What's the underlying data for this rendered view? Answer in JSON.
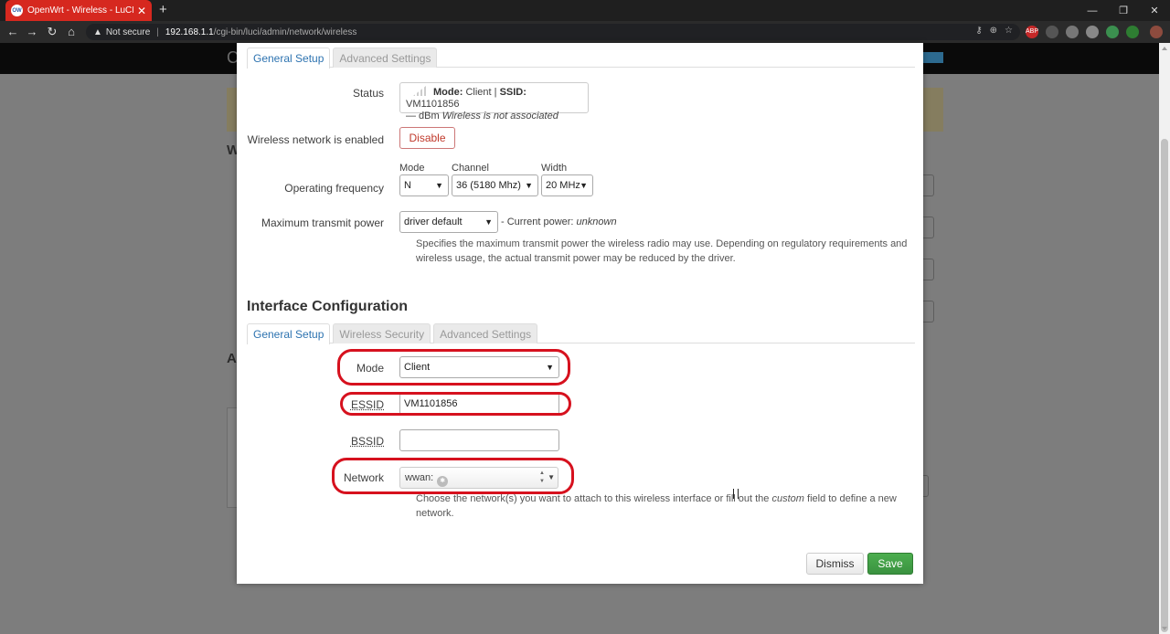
{
  "browser": {
    "tab_title": "OpenWrt - Wireless - LuCI",
    "tab_close": "✕",
    "new_tab": "+",
    "security": "Not secure",
    "url_host": "192.168.1.1",
    "url_path": "/cgi-bin/luci/admin/network/wireless",
    "window_minimize": "—",
    "window_restore": "❐",
    "window_close": "✕"
  },
  "modal": {
    "device_tabs": [
      "General Setup",
      "Advanced Settings"
    ],
    "status": {
      "label": "Status",
      "mode_key": "Mode:",
      "mode_value": "Client",
      "ssid_key": "SSID:",
      "ssid_value": "VM1101856",
      "signal": "— dBm",
      "assoc": "Wireless is not associated"
    },
    "enabled": {
      "label": "Wireless network is enabled",
      "button": "Disable"
    },
    "frequency": {
      "label": "Operating frequency",
      "mode_label": "Mode",
      "mode_value": "N",
      "channel_label": "Channel",
      "channel_value": "36 (5180 Mhz)",
      "width_label": "Width",
      "width_value": "20 MHz"
    },
    "txpower": {
      "label": "Maximum transmit power",
      "value": "driver default",
      "current_prefix": "- Current power:",
      "current_value": "unknown",
      "help_line1": "Specifies the maximum transmit power the wireless radio may use. Depending on regulatory requirements and",
      "help_line2": "wireless usage, the actual transmit power may be reduced by the driver."
    },
    "iface_title": "Interface Configuration",
    "iface_tabs": [
      "General Setup",
      "Wireless Security",
      "Advanced Settings"
    ],
    "mode": {
      "label": "Mode",
      "value": "Client"
    },
    "essid": {
      "label": "ESSID",
      "value": "VM1101856"
    },
    "bssid": {
      "label": "BSSID",
      "value": ""
    },
    "network": {
      "label": "Network",
      "value": "wwan:",
      "help_pre": "Choose the network(s) you want to attach to this wireless interface or fill out the",
      "help_em": "custom",
      "help_post": "field to define a new",
      "help_line2": "network."
    },
    "buttons": {
      "dismiss": "Dismiss",
      "save": "Save"
    }
  },
  "colors": {
    "highlight": "#d6111e",
    "save_green": "#43a047",
    "tab_active": "#2d73b0",
    "disable_red": "#c0392b"
  }
}
